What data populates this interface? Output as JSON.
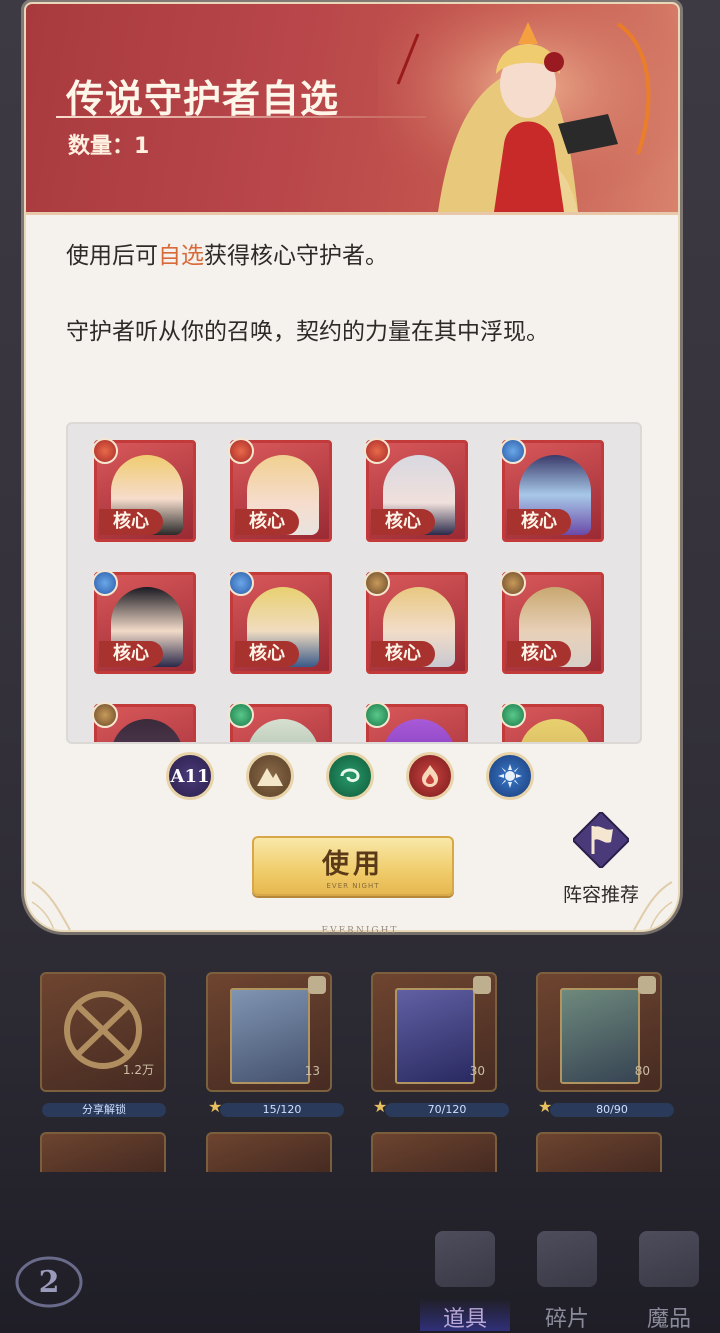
{
  "popup": {
    "title": "传说守护者自选",
    "count_label": "数量：1",
    "desc_prefix": "使用后可",
    "desc_highlight": "自选",
    "desc_suffix": "获得核心守护者。",
    "flavor_text": "守护者听从你的召唤，契约的力量在其中浮现。",
    "footer_brand": "EVERNIGHT"
  },
  "heroes": [
    {
      "element": "fire",
      "tag": "核心"
    },
    {
      "element": "fire",
      "tag": "核心"
    },
    {
      "element": "fire",
      "tag": "核心"
    },
    {
      "element": "ice",
      "tag": "核心"
    },
    {
      "element": "ice",
      "tag": "核心"
    },
    {
      "element": "ice",
      "tag": "核心"
    },
    {
      "element": "earth",
      "tag": "核心"
    },
    {
      "element": "earth",
      "tag": "核心"
    },
    {
      "element": "earth",
      "tag": ""
    },
    {
      "element": "wind",
      "tag": ""
    },
    {
      "element": "wind",
      "tag": ""
    },
    {
      "element": "wind",
      "tag": ""
    }
  ],
  "filters": {
    "all_label": "A11",
    "items": [
      "all",
      "earth",
      "wind",
      "fire",
      "ice"
    ]
  },
  "actions": {
    "use_label": "使用",
    "use_sub": "EVER NIGHT",
    "lineup_label": "阵容推荐"
  },
  "inventory_bg": {
    "cards": [
      {
        "rank": "1.2万",
        "bar": "分享解锁"
      },
      {
        "rank": "13",
        "bar": "15/120"
      },
      {
        "rank": "30",
        "bar": "70/120"
      },
      {
        "rank": "80",
        "bar": "80/90"
      }
    ]
  },
  "bottom_nav": {
    "tabs": [
      "道具",
      "碎片",
      "魔品"
    ],
    "active": "道具"
  },
  "colors": {
    "header_red": "#b8464a",
    "accent_orange": "#d86a3a",
    "gold_button": "#f0cc6a"
  }
}
